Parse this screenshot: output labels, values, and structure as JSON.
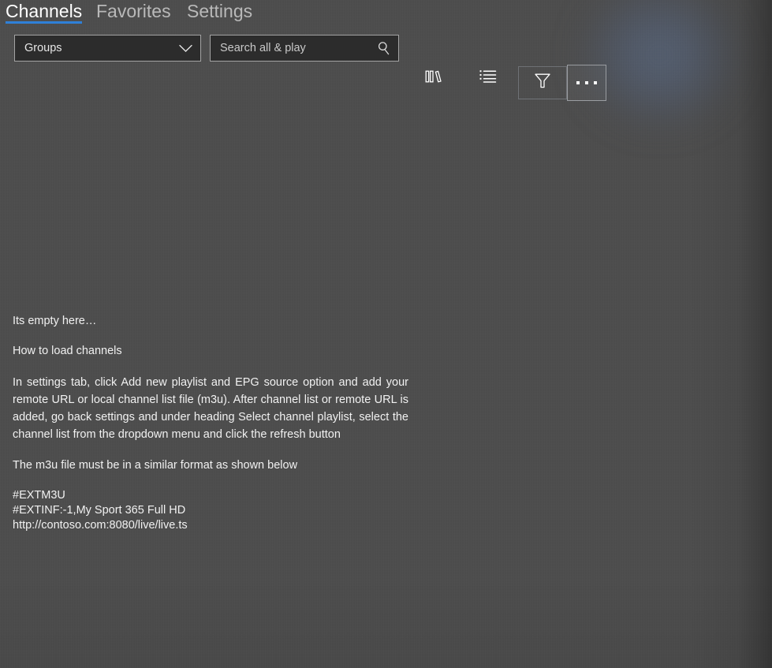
{
  "window": {
    "title": "Channels",
    "background_color": "#4b4b4b",
    "accent_color": "#2f80d8"
  },
  "tabs": [
    {
      "label": "Channels",
      "active": true
    },
    {
      "label": "Favorites",
      "active": false
    },
    {
      "label": "Settings",
      "active": false
    }
  ],
  "toolbar": {
    "group_filter": {
      "value": "Groups",
      "chevron_icon": "chevron-down-icon"
    },
    "search": {
      "value": "",
      "placeholder": "Search all & play",
      "icon": "search-icon"
    },
    "buttons": [
      {
        "name": "library-view-button",
        "icon": "books-icon",
        "label": ""
      },
      {
        "name": "list-view-button",
        "icon": "list-icon",
        "label": ""
      },
      {
        "name": "filter-button",
        "icon": "funnel-icon",
        "label": ""
      },
      {
        "name": "more-options-button",
        "icon": "ellipsis-icon",
        "label": ""
      }
    ]
  },
  "empty_state": {
    "headline": "Its empty here…",
    "subheading": "How to load  channels",
    "instructions": "In settings tab, click Add new playlist and EPG source  option and add your remote URL or local channel list file (m3u). After channel list or remote URL is added, go back settings and under heading  Select channel playlist, select the channel list from the dropdown menu and click the refresh button",
    "format_note": "The m3u file must be in a similar format as shown below",
    "sample": "#EXTM3U\n#EXTINF:-1,My Sport 365 Full HD\nhttp://contoso.com:8080/live/live.ts"
  }
}
